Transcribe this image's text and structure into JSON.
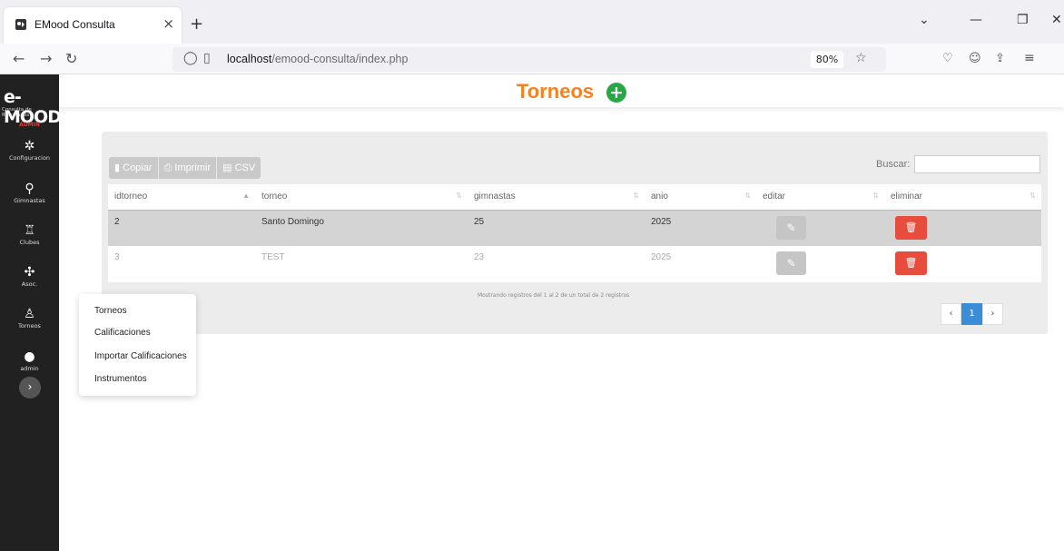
{
  "browser": {
    "tab_title": "EMood Consulta",
    "tab_close": "×",
    "new_tab": "+",
    "url_host": "localhost",
    "url_path": "/emood-consulta/index.php",
    "zoom": "80%"
  },
  "sidebar": {
    "logo": "e-MOOD",
    "logo_sub": "Consulta de Resultados",
    "role": "ADMIN",
    "items": [
      {
        "label": "Configuracion",
        "icon": "gear-icon"
      },
      {
        "label": "Gimnastas",
        "icon": "gymnast-icon"
      },
      {
        "label": "Clubes",
        "icon": "clubs-icon"
      },
      {
        "label": "Asoc.",
        "icon": "association-icon"
      },
      {
        "label": "Torneos",
        "icon": "tournament-icon"
      },
      {
        "label": "admin",
        "icon": "user-icon"
      }
    ]
  },
  "header": {
    "title": "Torneos"
  },
  "toolbar": {
    "copy": "Copiar",
    "print": "Imprimir",
    "csv": "CSV",
    "search_label": "Buscar:"
  },
  "table": {
    "columns": [
      "idtorneo",
      "torneo",
      "gimnastas",
      "anio",
      "editar",
      "eliminar"
    ],
    "rows": [
      {
        "idtorneo": "2",
        "torneo": "Santo Domingo",
        "gimnastas": "25",
        "anio": "2025"
      },
      {
        "idtorneo": "3",
        "torneo": "TEST",
        "gimnastas": "23",
        "anio": "2025"
      }
    ],
    "info": "Mostrando registros del 1 al 2 de un total de 2 registros",
    "page": "1"
  },
  "dropdown": {
    "items": [
      "Torneos",
      "Calificaciones",
      "Importar Calificaciones",
      "Instrumentos"
    ]
  },
  "colors": {
    "accent": "#f58220",
    "add_green": "#28a745",
    "delete_red": "#e74c3c",
    "sidebar_bg": "#212121",
    "page_active": "#3c8dd8"
  }
}
